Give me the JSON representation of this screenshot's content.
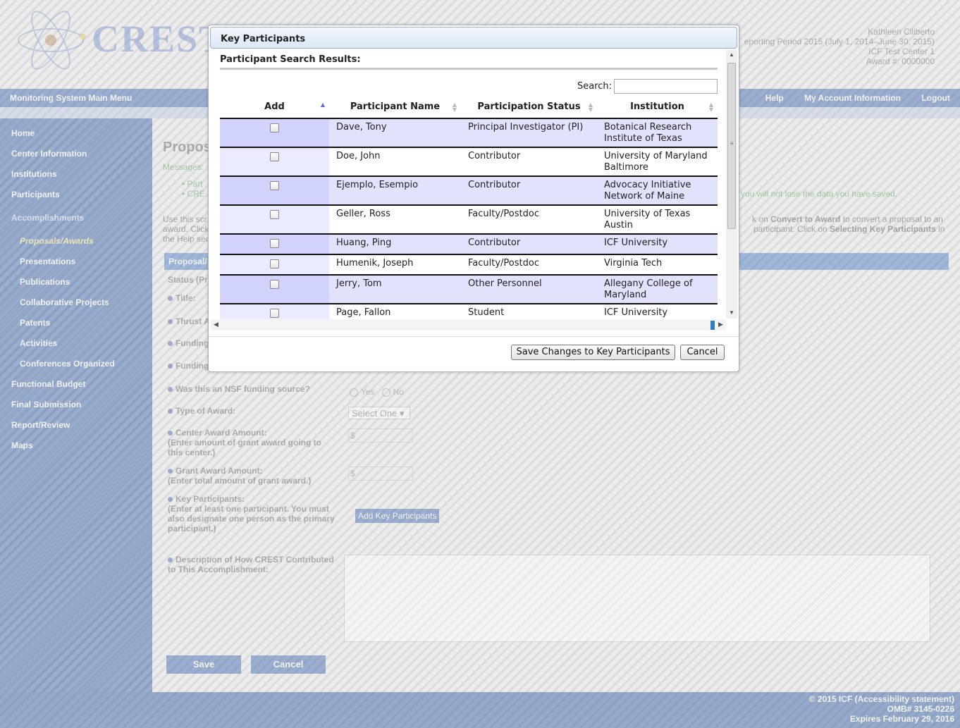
{
  "header": {
    "brand": "CRESTW",
    "user_name": "Kathleen Ciliberto",
    "reporting_period": "eporting Period 2015 (July 1, 2014–June 30, 2015)",
    "center": "ICF Test Center 1",
    "award": "Award #: 0000000"
  },
  "menubar": {
    "main_menu": "Monitoring System Main Menu",
    "help": "Help",
    "account": "My Account Information",
    "logout": "Logout"
  },
  "sidebar": {
    "items": [
      {
        "label": "Home"
      },
      {
        "label": "Center Information"
      },
      {
        "label": "Institutions"
      },
      {
        "label": "Participants"
      },
      {
        "label": "Accomplishments"
      },
      {
        "label": "Proposals/Awards"
      },
      {
        "label": "Presentations"
      },
      {
        "label": "Publications"
      },
      {
        "label": "Collaborative Projects"
      },
      {
        "label": "Patents"
      },
      {
        "label": "Activities"
      },
      {
        "label": "Conferences Organized"
      },
      {
        "label": "Functional Budget"
      },
      {
        "label": "Final Submission"
      },
      {
        "label": "Report/Review"
      },
      {
        "label": "Maps"
      }
    ]
  },
  "content": {
    "title": "Propos",
    "messages_label": "Messages:",
    "bullet1": "Part",
    "bullet2": "CRE",
    "green_tail": "you will not lose the data you have saved.",
    "intro_left1": "Use this scr",
    "intro_left2": "award. Click",
    "intro_left3": "the Help sec",
    "intro_right1a": "k on ",
    "intro_right1b": "Convert to Award",
    "intro_right1c": " to convert a proposal to an",
    "intro_right2a": "participant. Click on ",
    "intro_right2b": "Selecting Key Participants",
    "intro_right2c": " in",
    "section_bar": "Proposal/",
    "status_label": "Status (Pr",
    "title_label": "Title:",
    "thrust_label": "Thrust A",
    "funding1_label": "Funding",
    "funding2_label": "Funding",
    "nsf_label": "Was this an NSF funding source?",
    "yes": "Yes",
    "no": "No",
    "award_type_label": "Type of Award:",
    "award_type_value": "Select One",
    "center_amount_label": "Center Award Amount:",
    "center_amount_help": "(Enter amount of grant award going to this center.)",
    "grant_amount_label": "Grant Award Amount:",
    "grant_amount_help": "(Enter total amount of grant award.)",
    "currency": "$",
    "key_label": "Key Participants:",
    "key_help": "(Enter at least one participant. You must also designate one person as the primary participant.)",
    "add_key_button": "Add Key Participants",
    "desc_label": "Description of How CREST Contributed to This Accomplishment:",
    "save": "Save",
    "cancel": "Cancel"
  },
  "footer": {
    "line1": "© 2015 ICF (Accessibility statement)",
    "line2": "OMB# 3145-0226",
    "line3": "Expires February 29, 2016"
  },
  "dialog": {
    "title": "Key Participants",
    "results_label": "Participant Search Results:",
    "search_label": "Search:",
    "search_value": "",
    "columns": [
      "Add",
      "Participant Name",
      "Participation Status",
      "Institution"
    ],
    "rows": [
      {
        "name": "Dave, Tony",
        "status": "Principal Investigator (PI)",
        "institution": "Botanical Research Institute of Texas"
      },
      {
        "name": "Doe, John",
        "status": "Contributor",
        "institution": "University of Maryland Baltimore"
      },
      {
        "name": "Ejemplo, Esempio",
        "status": "Contributor",
        "institution": "Advocacy Initiative Network of Maine"
      },
      {
        "name": "Geller, Ross",
        "status": "Faculty/Postdoc",
        "institution": "University of Texas Austin"
      },
      {
        "name": "Huang, Ping",
        "status": "Contributor",
        "institution": "ICF University"
      },
      {
        "name": "Humenik, Joseph",
        "status": "Faculty/Postdoc",
        "institution": "Virginia Tech"
      },
      {
        "name": "Jerry, Tom",
        "status": "Other Personnel",
        "institution": "Allegany College of Maryland"
      },
      {
        "name": "Page, Fallon",
        "status": "Student",
        "institution": "ICF University"
      }
    ],
    "save_button": "Save Changes to Key Participants",
    "cancel_button": "Cancel"
  }
}
